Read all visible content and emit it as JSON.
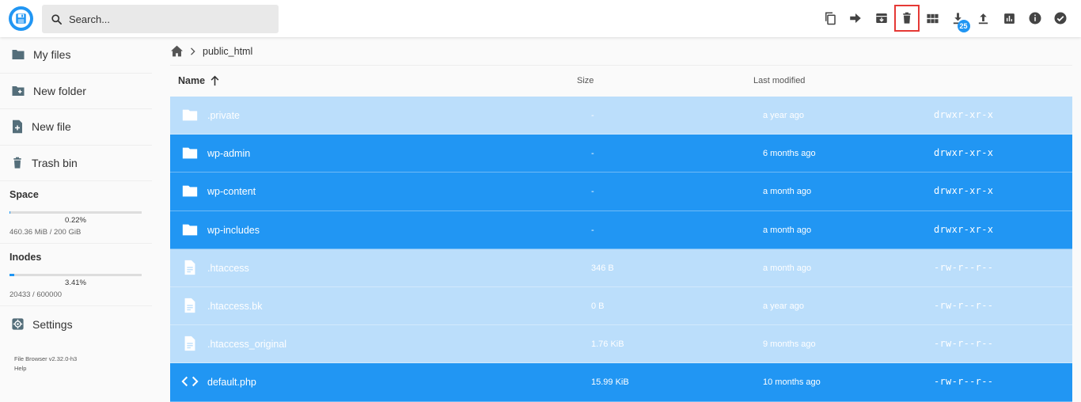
{
  "app": {
    "name": "File Browser"
  },
  "search": {
    "placeholder": "Search..."
  },
  "toolbar": {
    "items": [
      {
        "name": "copy",
        "icon": "copy-icon"
      },
      {
        "name": "move",
        "icon": "move-arrow-icon"
      },
      {
        "name": "archive",
        "icon": "archive-icon"
      },
      {
        "name": "delete",
        "icon": "trash-icon",
        "highlighted": true
      },
      {
        "name": "view-mode",
        "icon": "grid-icon"
      },
      {
        "name": "download",
        "icon": "download-icon",
        "badge": "25"
      },
      {
        "name": "upload",
        "icon": "upload-icon"
      },
      {
        "name": "usage",
        "icon": "chart-icon"
      },
      {
        "name": "info",
        "icon": "info-icon"
      },
      {
        "name": "select",
        "icon": "check-circle-icon"
      }
    ]
  },
  "sidebar": {
    "items": [
      {
        "label": "My files",
        "icon": "folder-icon"
      },
      {
        "label": "New folder",
        "icon": "folder-plus-icon"
      },
      {
        "label": "New file",
        "icon": "file-plus-icon"
      },
      {
        "label": "Trash bin",
        "icon": "trash-icon"
      }
    ],
    "space": {
      "title": "Space",
      "percent_label": "0.22%",
      "fraction": 0.0022,
      "detail": "460.36 MiB / 200 GiB"
    },
    "inodes": {
      "title": "Inodes",
      "percent_label": "3.41%",
      "fraction": 0.0341,
      "detail": "20433 / 600000"
    },
    "settings": {
      "label": "Settings",
      "icon": "gear-icon"
    },
    "footer": {
      "version": "File Browser v2.32.0-h3",
      "help": "Help"
    }
  },
  "breadcrumb": {
    "home_icon": "home-icon",
    "path": [
      "public_html"
    ]
  },
  "table": {
    "headers": {
      "name": "Name",
      "size": "Size",
      "modified": "Last modified"
    },
    "sort": {
      "column": "name",
      "direction": "ascending",
      "icon": "arrow-up-icon"
    },
    "rows": [
      {
        "name": ".private",
        "size": "-",
        "modified": "a year ago",
        "perms": "drwxr-xr-x",
        "type": "folder",
        "selected": false
      },
      {
        "name": "wp-admin",
        "size": "-",
        "modified": "6 months ago",
        "perms": "drwxr-xr-x",
        "type": "folder",
        "selected": true
      },
      {
        "name": "wp-content",
        "size": "-",
        "modified": "a month ago",
        "perms": "drwxr-xr-x",
        "type": "folder",
        "selected": true
      },
      {
        "name": "wp-includes",
        "size": "-",
        "modified": "a month ago",
        "perms": "drwxr-xr-x",
        "type": "folder",
        "selected": true
      },
      {
        "name": ".htaccess",
        "size": "346 B",
        "modified": "a month ago",
        "perms": "-rw-r--r--",
        "type": "file",
        "selected": false
      },
      {
        "name": ".htaccess.bk",
        "size": "0 B",
        "modified": "a year ago",
        "perms": "-rw-r--r--",
        "type": "file",
        "selected": false
      },
      {
        "name": ".htaccess_original",
        "size": "1.76 KiB",
        "modified": "9 months ago",
        "perms": "-rw-r--r--",
        "type": "file",
        "selected": false
      },
      {
        "name": "default.php",
        "size": "15.99 KiB",
        "modified": "10 months ago",
        "perms": "-rw-r--r--",
        "type": "code",
        "selected": true
      }
    ]
  },
  "colors": {
    "accent": "#2196f3",
    "selected_row": "#2196f3",
    "unselected_row": "#bbdefb",
    "highlight_box": "#e53935"
  }
}
